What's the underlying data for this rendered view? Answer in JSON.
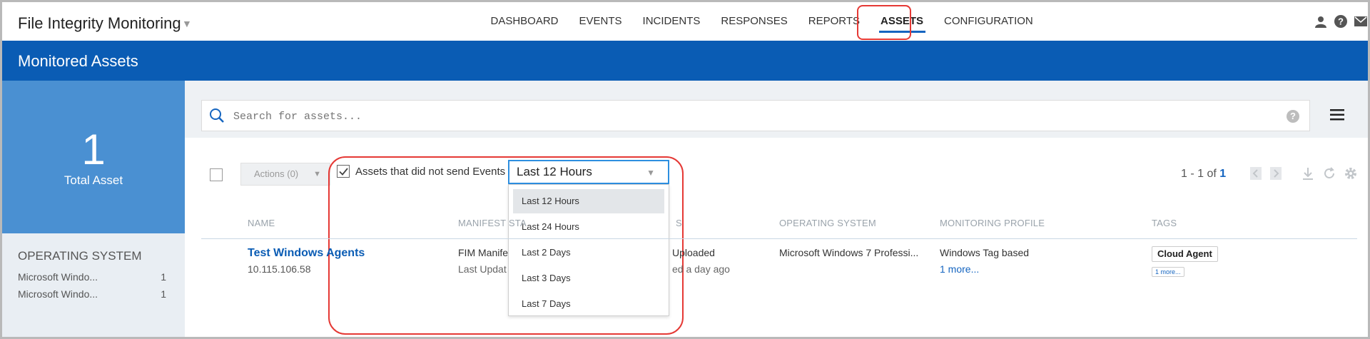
{
  "app": {
    "title": "File Integrity Monitoring"
  },
  "nav": {
    "items": [
      {
        "label": "DASHBOARD",
        "active": false
      },
      {
        "label": "EVENTS",
        "active": false
      },
      {
        "label": "INCIDENTS",
        "active": false
      },
      {
        "label": "RESPONSES",
        "active": false
      },
      {
        "label": "REPORTS",
        "active": false
      },
      {
        "label": "ASSETS",
        "active": true
      },
      {
        "label": "CONFIGURATION",
        "active": false
      }
    ]
  },
  "top_icons": [
    "user-icon",
    "help-icon",
    "mail-icon"
  ],
  "header": {
    "title": "Monitored Assets"
  },
  "summary": {
    "count": "1",
    "label": "Total Asset"
  },
  "os_filter": {
    "title": "OPERATING SYSTEM",
    "rows": [
      {
        "name": "Microsoft Windo...",
        "count": "1"
      },
      {
        "name": "Microsoft Windo...",
        "count": "1"
      }
    ]
  },
  "search": {
    "placeholder": "Search for assets...",
    "help": "?"
  },
  "toolbar": {
    "actions_label": "Actions (0)",
    "filter_label": "Assets that did not send Events",
    "filter_checked": true,
    "range_selected": "Last 12 Hours",
    "range_options": [
      "Last 12 Hours",
      "Last 24 Hours",
      "Last 2 Days",
      "Last 3 Days",
      "Last 7 Days"
    ]
  },
  "pager": {
    "range": "1 - 1 of",
    "total": "1"
  },
  "table": {
    "headers": {
      "name": "NAME",
      "manifest": "MANIFEST STA",
      "status_tail": "S",
      "os": "OPERATING SYSTEM",
      "profile": "MONITORING PROFILE",
      "tags": "TAGS"
    },
    "rows": [
      {
        "name": "Test Windows Agents",
        "ip": "10.115.106.58",
        "manifest": "FIM Manife",
        "manifest_sub": "Last Updat",
        "status": "Uploaded",
        "status_sub": "ed a day ago",
        "os": "Microsoft Windows 7 Professi...",
        "profile": "Windows Tag based",
        "profile_more": "1 more...",
        "tag": "Cloud Agent",
        "tag_more": "1 more..."
      }
    ]
  },
  "colors": {
    "brand_blue": "#0a5cb4",
    "summary_blue": "#4a90d2",
    "highlight_red": "#e53935",
    "select_border": "#2d8fe0"
  }
}
